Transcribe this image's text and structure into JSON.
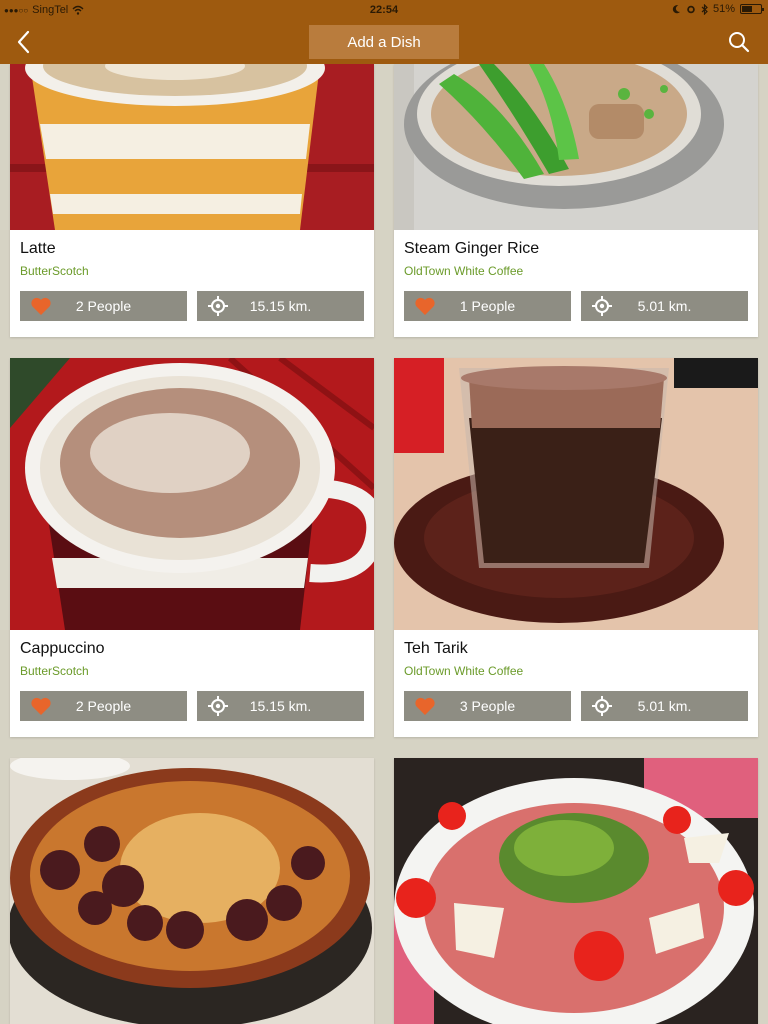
{
  "status": {
    "carrier": "SingTel",
    "time": "22:54",
    "battery": "51%",
    "battery_level": 0.51
  },
  "nav": {
    "title_button": "Add a Dish",
    "back_icon": "chevron-left-icon",
    "search_icon": "search-icon"
  },
  "colors": {
    "bar": "#9e5a0f",
    "button": "#b97c3d",
    "pill": "#8e8d83",
    "place": "#6b9b2a",
    "heart": "#e8652b"
  },
  "dishes": [
    {
      "name": "Latte",
      "place": "ButterScotch",
      "likes": "2 People",
      "distance": "15.15 km."
    },
    {
      "name": "Steam Ginger Rice",
      "place": "OldTown White Coffee",
      "likes": "1 People",
      "distance": "5.01 km."
    },
    {
      "name": "Cappuccino",
      "place": "ButterScotch",
      "likes": "2 People",
      "distance": "15.15 km."
    },
    {
      "name": "Teh Tarik",
      "place": "OldTown White Coffee",
      "likes": "3 People",
      "distance": "5.01 km."
    }
  ]
}
